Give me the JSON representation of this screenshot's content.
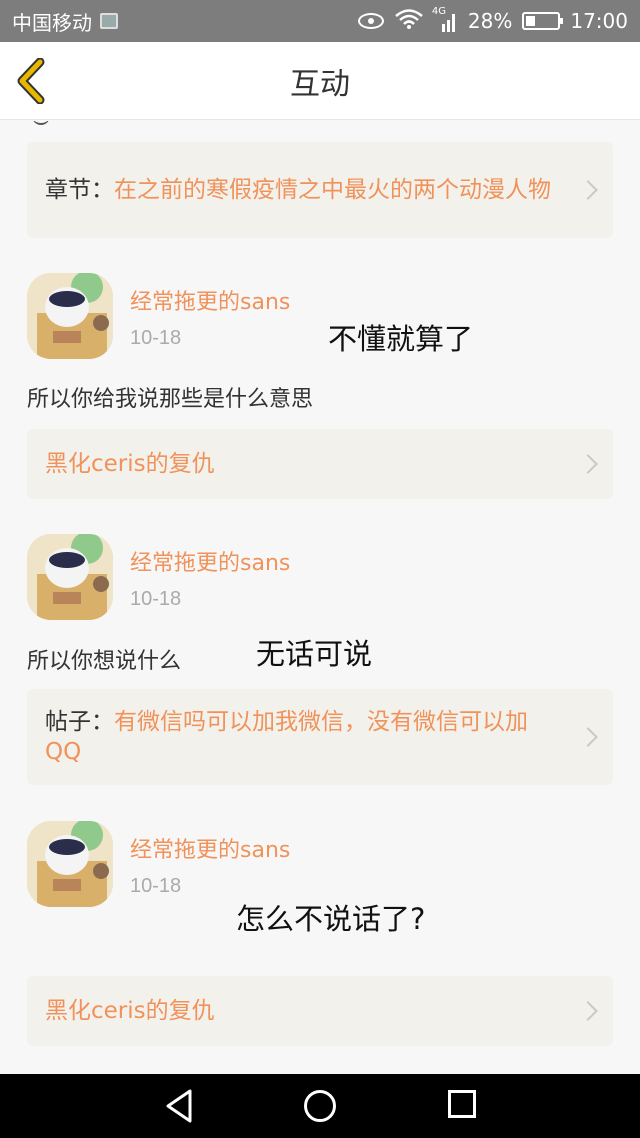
{
  "status_bar": {
    "carrier": "中国移动",
    "network_type": "4G",
    "battery": "28%",
    "time": "17:00"
  },
  "header": {
    "title": "互动"
  },
  "items": [
    {
      "ref_prefix": "章节：",
      "ref_text": "在之前的寒假疫情之中最火的两个动漫人物"
    },
    {
      "username": "经常拖更的sans",
      "date": "10-18",
      "message": "所以你给我说那些是什么意思",
      "annotation": "不懂就算了",
      "ref_prefix": "",
      "ref_text": "黑化ceris的复仇"
    },
    {
      "username": "经常拖更的sans",
      "date": "10-18",
      "message": "所以你想说什么",
      "annotation": "无话可说",
      "ref_prefix": "帖子：",
      "ref_text": "有微信吗可以加我微信，没有微信可以加QQ"
    },
    {
      "username": "经常拖更的sans",
      "date": "10-18",
      "message": "",
      "annotation": "怎么不说话了?",
      "ref_prefix": "",
      "ref_text": "黑化ceris的复仇"
    }
  ],
  "colors": {
    "accent": "#f0925a",
    "back_arrow": "#e8b800"
  }
}
